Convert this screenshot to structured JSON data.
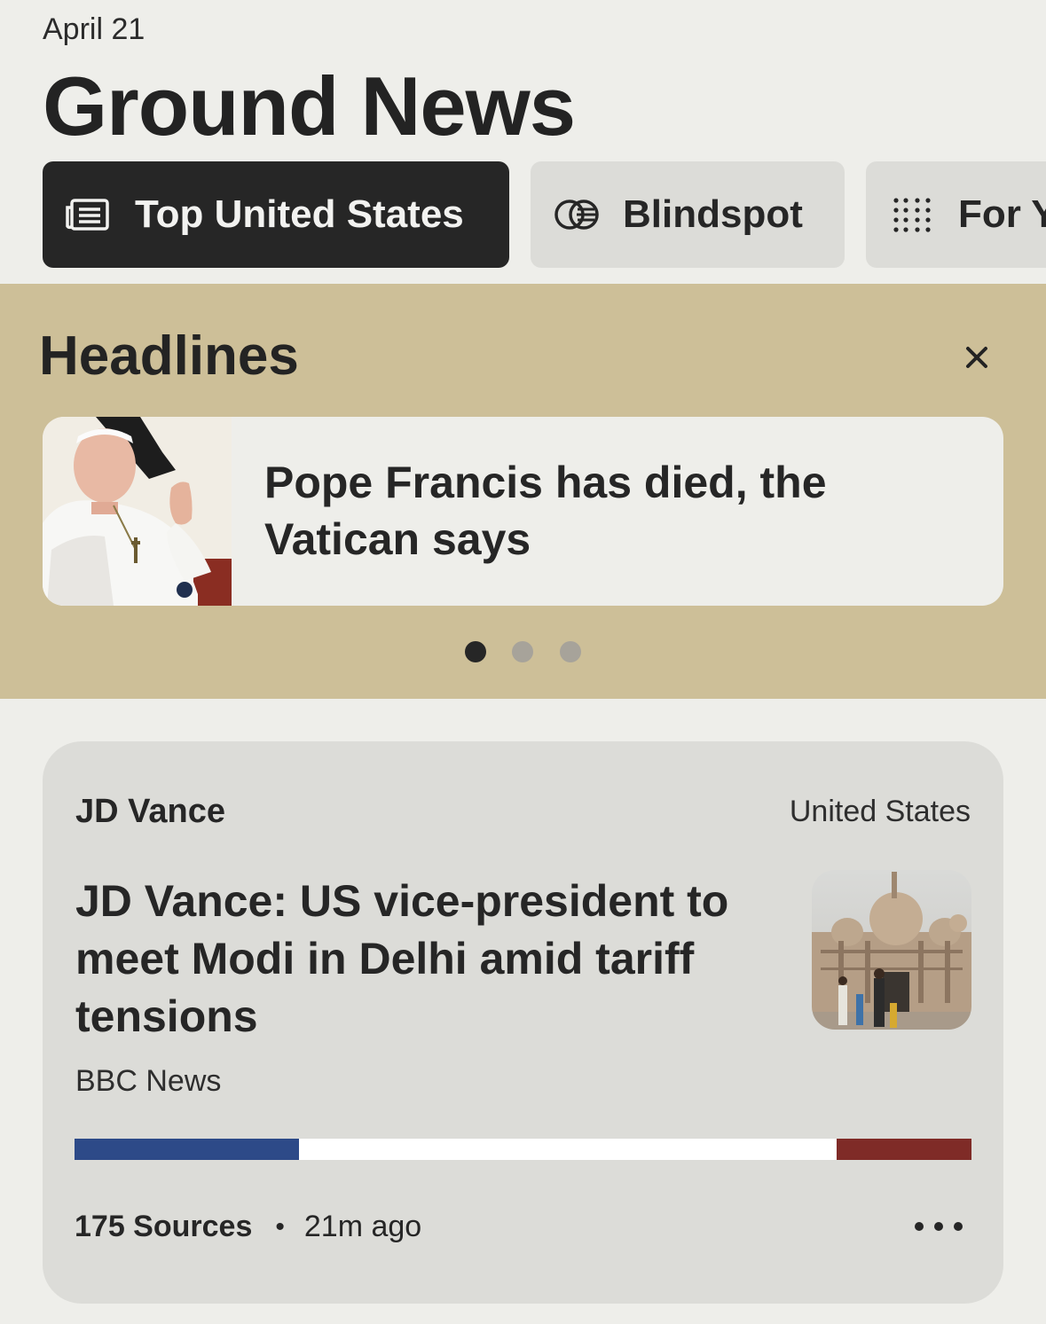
{
  "header": {
    "date": "April 21",
    "title": "Ground News"
  },
  "tabs": [
    {
      "label": "Top United States",
      "icon": "newspaper-icon",
      "active": true
    },
    {
      "label": "Blindspot",
      "icon": "blindspot-icon",
      "active": false
    },
    {
      "label": "For Y",
      "icon": "dots-grid-icon",
      "active": false
    }
  ],
  "headlines": {
    "title": "Headlines",
    "card": {
      "text": "Pope Francis has died, the Vatican says"
    },
    "pager": {
      "count": 3,
      "active_index": 0
    }
  },
  "story": {
    "topic": "JD Vance",
    "region": "United States",
    "title": "JD Vance: US vice-president to meet Modi in Delhi amid tariff tensions",
    "source": "BBC News",
    "bias": [
      {
        "name": "left",
        "fraction": 0.25,
        "color": "#2d4a88"
      },
      {
        "name": "center",
        "fraction": 0.6,
        "color": "#ffffff"
      },
      {
        "name": "right",
        "fraction": 0.15,
        "color": "#7f2b27"
      }
    ],
    "sources_count": "175 Sources",
    "separator": "•",
    "time_ago": "21m ago"
  },
  "colors": {
    "background": "#eeeeea",
    "headlines_bg": "#cdbf98",
    "card_bg": "#dcdcd8",
    "active_tab": "#262626"
  }
}
